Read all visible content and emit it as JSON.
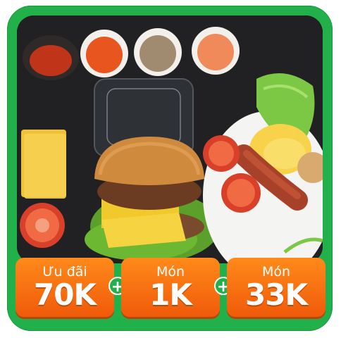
{
  "colors": {
    "frame_green": "#22b04b",
    "ticket_orange": "#f05a0a",
    "ticket_text": "#ffffff"
  },
  "promo": {
    "tickets": [
      {
        "caption": "Ưu đãi",
        "amount": "70K"
      },
      {
        "caption": "Món",
        "amount": "1K"
      },
      {
        "caption": "Món",
        "amount": "33K"
      }
    ],
    "separator": "+"
  },
  "icons": {
    "separator_icon": "plus-icon"
  }
}
